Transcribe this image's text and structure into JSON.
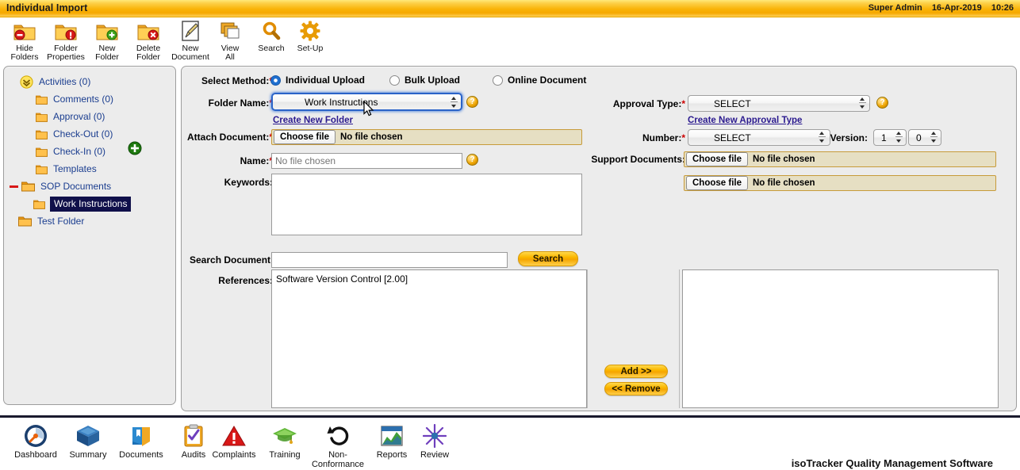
{
  "header": {
    "title": "Individual Import",
    "user": "Super Admin",
    "date": "16-Apr-2019",
    "time": "10:26"
  },
  "toolbar": {
    "items": [
      {
        "icon": "hide-folders-icon",
        "line1": "Hide",
        "line2": "Folders"
      },
      {
        "icon": "folder-properties-icon",
        "line1": "Folder",
        "line2": "Properties"
      },
      {
        "icon": "new-folder-icon",
        "line1": "New",
        "line2": "Folder"
      },
      {
        "icon": "delete-folder-icon",
        "line1": "Delete",
        "line2": "Folder"
      },
      {
        "icon": "new-document-icon",
        "line1": "New",
        "line2": "Document"
      },
      {
        "icon": "view-all-icon",
        "line1": "View",
        "line2": "All"
      },
      {
        "icon": "search-icon",
        "line1": "Search",
        "line2": ""
      },
      {
        "icon": "setup-gear-icon",
        "line1": "Set-Up",
        "line2": ""
      }
    ]
  },
  "tree": {
    "add_icon": "add-green-plus-icon",
    "nodes": [
      {
        "label": "Activities (0)",
        "icon": "expand-chevron-icon",
        "indent": 0,
        "selected": false
      },
      {
        "label": "Comments (0)",
        "icon": "folder-icon",
        "indent": 1,
        "selected": false
      },
      {
        "label": "Approval (0)",
        "icon": "folder-icon",
        "indent": 1,
        "selected": false
      },
      {
        "label": "Check-Out (0)",
        "icon": "folder-icon",
        "indent": 1,
        "selected": false
      },
      {
        "label": "Check-In (0)",
        "icon": "folder-icon",
        "indent": 1,
        "selected": false
      },
      {
        "label": "Templates",
        "icon": "folder-icon",
        "indent": 1,
        "selected": false
      },
      {
        "label": "SOP Documents",
        "icon": "folder-open-icon",
        "indent": 0,
        "selected": false,
        "collapse": "minus-icon"
      },
      {
        "label": "Work Instructions",
        "icon": "folder-icon",
        "indent": 1,
        "selected": true
      },
      {
        "label": "Test Folder",
        "icon": "folder-icon",
        "indent": 0,
        "selected": false
      }
    ]
  },
  "form": {
    "select_method_label": "Select Method:",
    "methods": [
      {
        "label": "Individual Upload",
        "selected": true
      },
      {
        "label": "Bulk Upload",
        "selected": false
      },
      {
        "label": "Online Document",
        "selected": false
      }
    ],
    "folder_name_label": "Folder Name:",
    "folder_name_value": "Work Instructions",
    "create_new_folder_link": "Create New Folder",
    "attach_document_label": "Attach Document:",
    "attach_choose_label": "Choose file",
    "attach_status": "No file chosen",
    "name_label": "Name:",
    "name_value": "",
    "name_placeholder": "No file chosen",
    "keywords_label": "Keywords:",
    "keywords_value": "",
    "search_document_label": "Search Document:",
    "search_document_value": "",
    "search_button_label": "Search",
    "references_label": "References:",
    "references_items": [
      "Software Version Control [2.00]"
    ],
    "approval_type_label": "Approval Type:",
    "approval_type_value": "SELECT",
    "create_new_approval_link": "Create New Approval Type",
    "number_label": "Number:",
    "number_value": "SELECT",
    "version_label": "Version:",
    "version_major": "1",
    "version_minor": "0",
    "support_documents_label": "Support Documents:",
    "support_choose_label": "Choose file",
    "support_status": "No file chosen",
    "support_choose_label_2": "Choose file",
    "support_status_2": "No file chosen",
    "add_button_label": "Add >>",
    "remove_button_label": "<< Remove",
    "selected_references": [],
    "help_icon": "help-question-icon"
  },
  "bottom_nav": {
    "items": [
      {
        "icon": "dashboard-gauge-icon",
        "line1": "Dashboard",
        "line2": ""
      },
      {
        "icon": "summary-cube-icon",
        "line1": "Summary",
        "line2": ""
      },
      {
        "icon": "documents-book-icon",
        "line1": "Documents",
        "line2": ""
      },
      {
        "icon": "audits-clipboard-icon",
        "line1": "Audits",
        "line2": ""
      },
      {
        "icon": "complaints-warning-icon",
        "line1": "Complaints",
        "line2": ""
      },
      {
        "icon": "training-cap-icon",
        "line1": "Training",
        "line2": ""
      },
      {
        "icon": "non-conformance-undo-icon",
        "line1": "Non-",
        "line2": "Conformance"
      },
      {
        "icon": "reports-chart-icon",
        "line1": "Reports",
        "line2": ""
      },
      {
        "icon": "review-star-icon",
        "line1": "Review",
        "line2": ""
      }
    ],
    "brand": "isoTracker Quality Management Software"
  },
  "colors": {
    "title_bar": "#f9b307",
    "panel_bg": "#ececec",
    "link": "#2b1a8f",
    "selection": "#10104a",
    "required": "#cc0000",
    "file_field_bg": "#e6dfc3",
    "gold_button": "#fbb800"
  }
}
